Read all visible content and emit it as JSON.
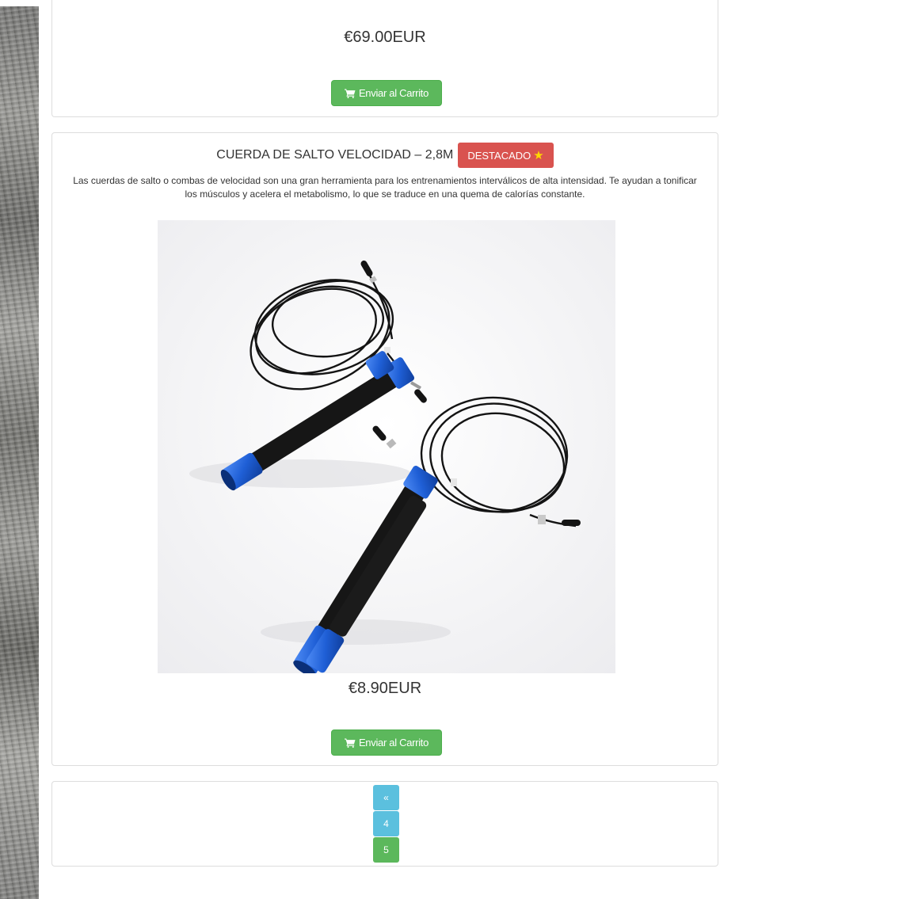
{
  "products": [
    {
      "price": "€69.00EUR",
      "cart_label": "Enviar al Carrito"
    },
    {
      "title": "CUERDA DE SALTO VELOCIDAD – 2,8M",
      "badge": "DESTACADO",
      "badge_icon": "star-icon",
      "description": "Las cuerdas de salto o combas de velocidad son una gran herramienta para los entrenamientos interválicos de alta intensidad. Te ayudan a tonificar los músculos y acelera el metabolismo, lo que se traduce en una quema de calorías constante.",
      "price": "€8.90EUR",
      "cart_label": "Enviar al Carrito"
    }
  ],
  "pagination": {
    "prev": "«",
    "pages": [
      "4",
      "5"
    ],
    "current": "5"
  },
  "colors": {
    "success": "#5cb85c",
    "danger": "#d9534f",
    "info": "#5bc0de",
    "handle_blue": "#1f5fd6"
  },
  "icons": {
    "cart": "shopping-cart-icon",
    "badge": "star-icon"
  }
}
